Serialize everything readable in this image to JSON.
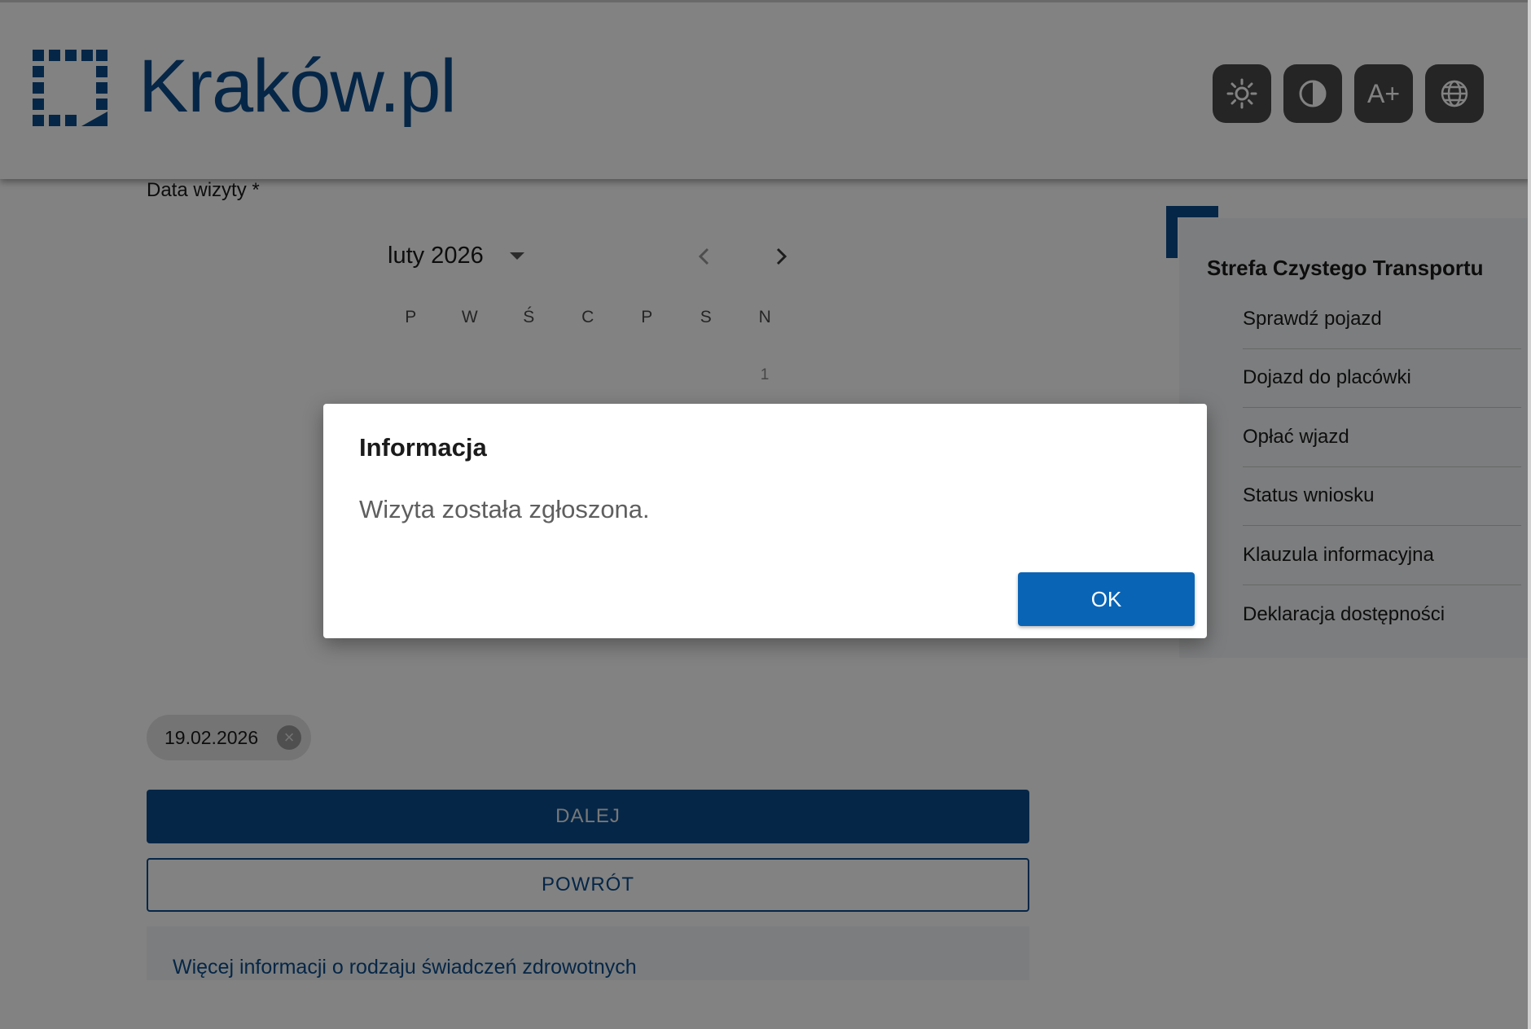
{
  "header": {
    "logo_text": "Kraków.pl",
    "tools": [
      {
        "icon": "brightness-icon",
        "label": ""
      },
      {
        "icon": "contrast-icon",
        "label": ""
      },
      {
        "icon": "font-size-icon",
        "label": "A+"
      },
      {
        "icon": "globe-icon",
        "label": ""
      }
    ]
  },
  "form": {
    "date_label": "Data wizyty *",
    "calendar": {
      "month_label": "luty 2026",
      "weekdays": [
        "P",
        "W",
        "Ś",
        "C",
        "P",
        "S",
        "N"
      ],
      "first_day": "1"
    },
    "selected_date": "19.02.2026",
    "next_button": "DALEJ",
    "back_button": "POWRÓT",
    "info_link": "Więcej informacji o rodzaju świadczeń zdrowotnych"
  },
  "sidebar": {
    "title": "Strefa Czystego Transportu",
    "items": [
      "Sprawdź pojazd",
      "Dojazd do placówki",
      "Opłać wjazd",
      "Status wniosku",
      "Klauzula informacyjna",
      "Deklaracja dostępności"
    ]
  },
  "dialog": {
    "title": "Informacja",
    "message": "Wizyta została zgłoszona.",
    "ok_button": "OK"
  },
  "colors": {
    "brand": "#0a4c8c",
    "dialog_button": "#0a64b6",
    "overlay": "rgba(0,0,0,0.49)"
  }
}
